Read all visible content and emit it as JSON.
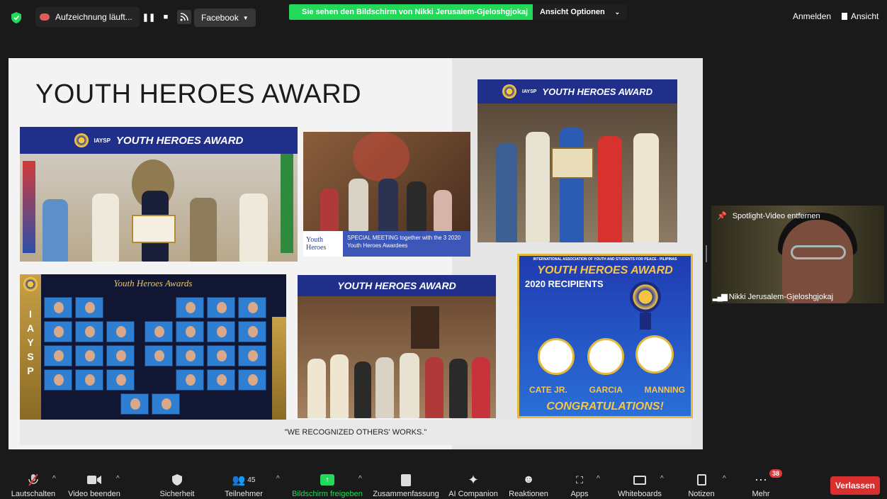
{
  "topbar": {
    "recording_label": "Aufzeichnung läuft...",
    "stream_label": "Facebook",
    "share_banner": "Sie sehen den Bildschirm von Nikki Jerusalem-Gjeloshgjokaj",
    "view_options": "Ansicht Optionen",
    "sign_in": "Anmelden",
    "view": "Ansicht"
  },
  "slide": {
    "title": "YOUTH HEROES AWARD",
    "photo1_banner": "YOUTH HEROES AWARD",
    "photo1_org": "IAYSP",
    "photo3_banner": "YOUTH HEROES AWARD",
    "photo3_org": "IAYSP",
    "photo2_brand": "Youth Heroes",
    "photo2_caption": "SPECIAL MEETING together with the 3 2020 Youth Heroes Awardees",
    "photo4_title": "Youth Heroes Awards",
    "photo4_letters": [
      "I",
      "A",
      "Y",
      "S",
      "P"
    ],
    "photo5_banner": "YOUTH HEROES AWARD",
    "poster": {
      "org": "INTERNATIONAL ASSOCIATION OF YOUTH AND STUDENTS FOR PEACE - PILIPINAS",
      "title": "YOUTH HEROES AWARD",
      "subtitle": "2020 RECIPIENTS",
      "names": [
        "CATE JR.",
        "GARCIA",
        "MANNING"
      ],
      "congrats": "CONGRATULATIONS!"
    },
    "caption": "\"WE RECOGNIZED OTHERS' WORKS.\""
  },
  "spotlight": {
    "remove_label": "Spotlight-Video entfernen",
    "participant_name": "Nikki Jerusalem-Gjeloshgjokaj"
  },
  "toolbar": {
    "mute": "Lautschalten",
    "video": "Video beenden",
    "security": "Sicherheit",
    "participants": "Teilnehmer",
    "participants_count": "45",
    "share": "Bildschirm freigeben",
    "summary": "Zusammenfassung",
    "ai": "AI Companion",
    "reactions": "Reaktionen",
    "apps": "Apps",
    "whiteboards": "Whiteboards",
    "notes": "Notizen",
    "more": "Mehr",
    "more_badge": "38",
    "leave": "Verlassen"
  },
  "colors": {
    "share_green": "#23d959",
    "leave_red": "#d9302f",
    "banner_blue": "#1f2f8a"
  }
}
